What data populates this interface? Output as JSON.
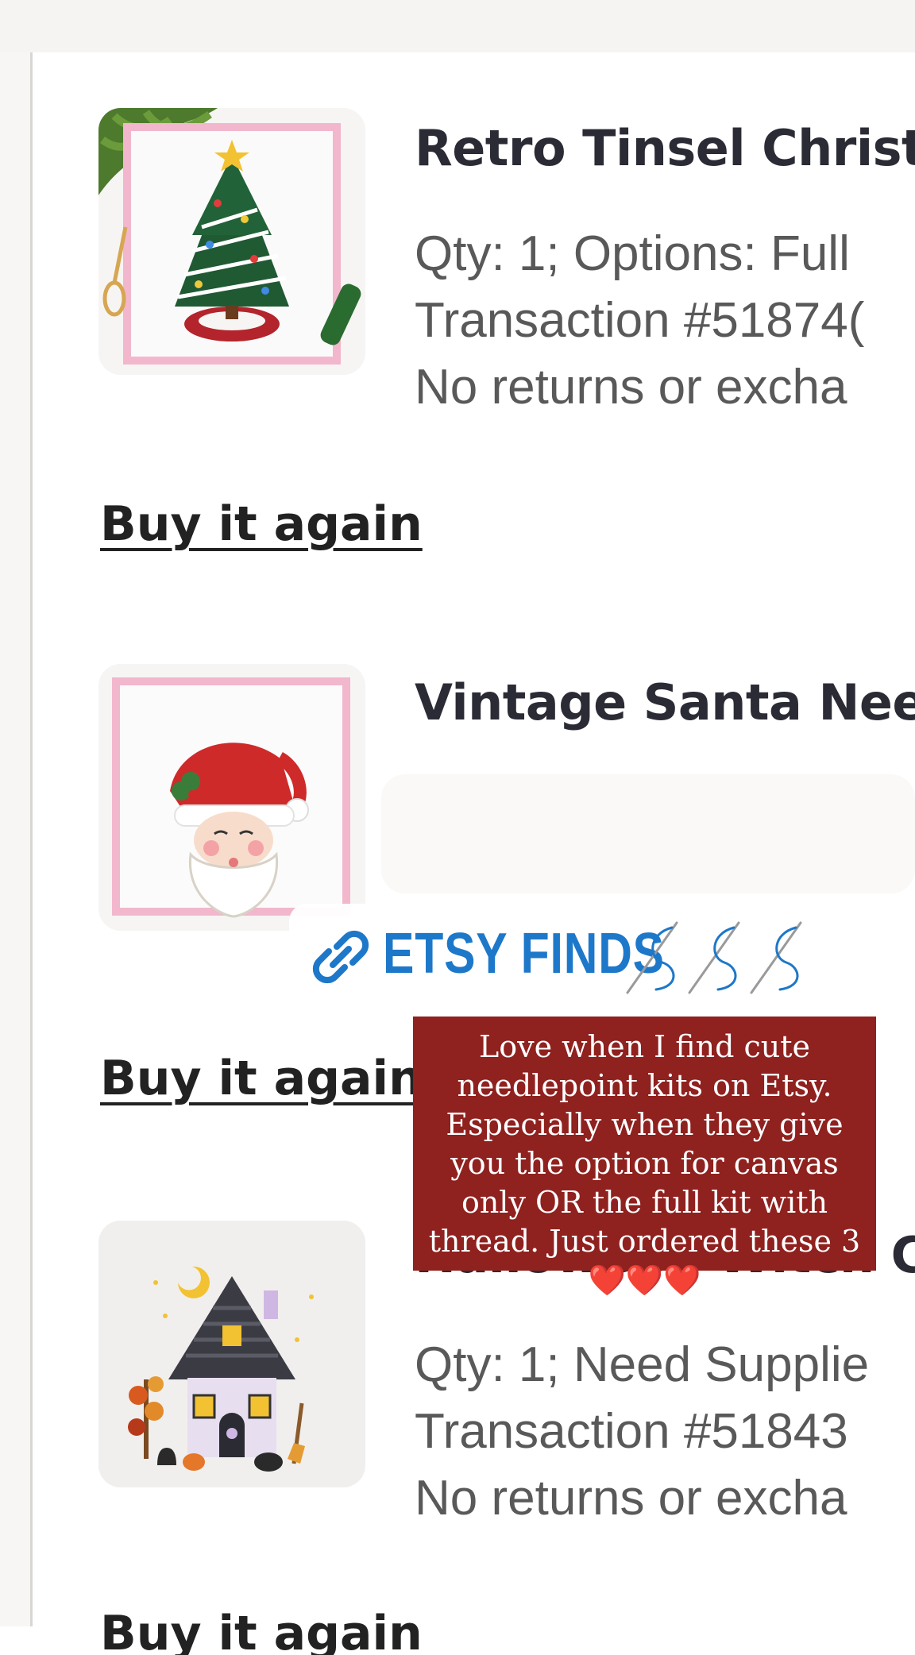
{
  "orders": [
    {
      "title": "Retro Tinsel Christr",
      "meta": [
        "Qty: 1; Options: Full",
        "Transaction #51874(",
        "No returns or excha"
      ],
      "buy_again": "Buy it again"
    },
    {
      "title": "Vintage Santa Nee(",
      "meta": [],
      "buy_again": "Buy it again"
    },
    {
      "title": "Halloween Witch C",
      "meta": [
        "Qty: 1; Need Supplie",
        "Transaction #51843",
        "No returns or excha"
      ],
      "buy_again": "Buy it again"
    }
  ],
  "story": {
    "link_sticker": {
      "label": "ETSY FINDS",
      "icon": "link-icon",
      "decoration": "needle-thread-icons"
    },
    "caption": {
      "text": "Love when I find cute needlepoint kits on Etsy. Especially when they give you the option for canvas only OR the full kit with thread. Just ordered these 3",
      "hearts": "❤️❤️❤️"
    }
  },
  "colors": {
    "caption_bg": "#8f211f",
    "link_blue": "#1d78c9",
    "title_text": "#2b2b35",
    "meta_text": "#595959"
  }
}
